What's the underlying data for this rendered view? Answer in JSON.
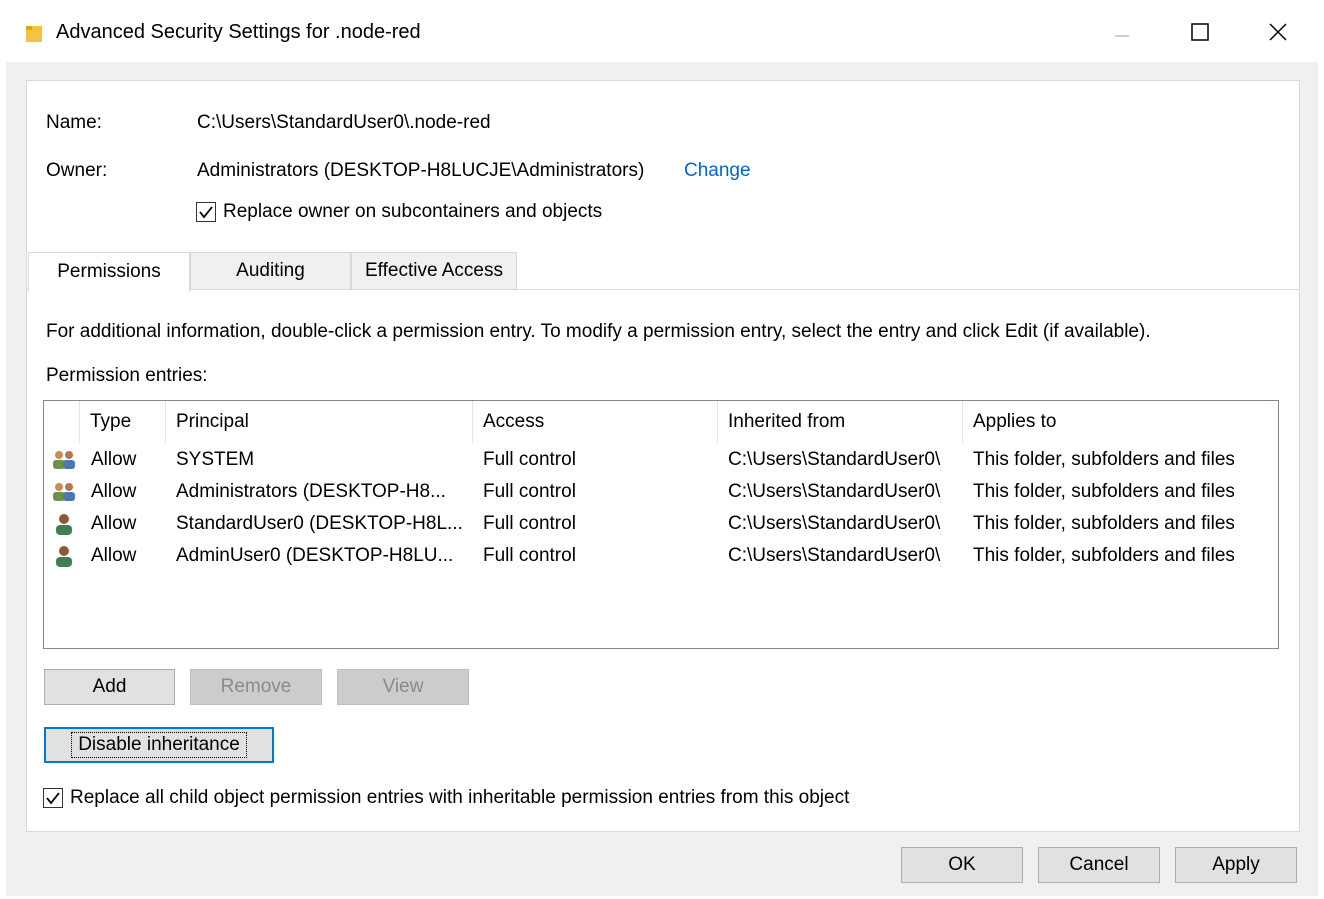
{
  "window": {
    "title": "Advanced Security Settings for .node-red",
    "folder_icon": "folder-icon",
    "colors": {
      "accent": "#0078d7",
      "link": "#0066cc",
      "folder": "#f5c342"
    }
  },
  "info": {
    "name_label": "Name:",
    "name_value": "C:\\Users\\StandardUser0\\.node-red",
    "owner_label": "Owner:",
    "owner_value": "Administrators (DESKTOP-H8LUCJE\\Administrators)",
    "change_link": "Change",
    "replace_owner_label": "Replace owner on subcontainers and objects",
    "replace_owner_checked": true
  },
  "tabs": [
    {
      "label": "Permissions",
      "active": true
    },
    {
      "label": "Auditing",
      "active": false
    },
    {
      "label": "Effective Access",
      "active": false
    }
  ],
  "permissions": {
    "info_text": "For additional information, double-click a permission entry. To modify a permission entry, select the entry and click Edit (if available).",
    "entries_label": "Permission entries:",
    "columns": [
      "Type",
      "Principal",
      "Access",
      "Inherited from",
      "Applies to"
    ],
    "rows": [
      {
        "icon": "group-icon",
        "type": "Allow",
        "principal": "SYSTEM",
        "access": "Full control",
        "inherited": "C:\\Users\\StandardUser0\\",
        "applies": "This folder, subfolders and files"
      },
      {
        "icon": "group-icon",
        "type": "Allow",
        "principal": "Administrators (DESKTOP-H8...",
        "access": "Full control",
        "inherited": "C:\\Users\\StandardUser0\\",
        "applies": "This folder, subfolders and files"
      },
      {
        "icon": "user-icon",
        "type": "Allow",
        "principal": "StandardUser0 (DESKTOP-H8L...",
        "access": "Full control",
        "inherited": "C:\\Users\\StandardUser0\\",
        "applies": "This folder, subfolders and files"
      },
      {
        "icon": "user-icon",
        "type": "Allow",
        "principal": "AdminUser0 (DESKTOP-H8LU...",
        "access": "Full control",
        "inherited": "C:\\Users\\StandardUser0\\",
        "applies": "This folder, subfolders and files"
      }
    ],
    "add_label": "Add",
    "remove_label": "Remove",
    "view_label": "View",
    "disable_inheritance_label": "Disable inheritance",
    "replace_child_label": "Replace all child object permission entries with inheritable permission entries from this object",
    "replace_child_checked": true
  },
  "footer": {
    "ok_label": "OK",
    "cancel_label": "Cancel",
    "apply_label": "Apply"
  }
}
